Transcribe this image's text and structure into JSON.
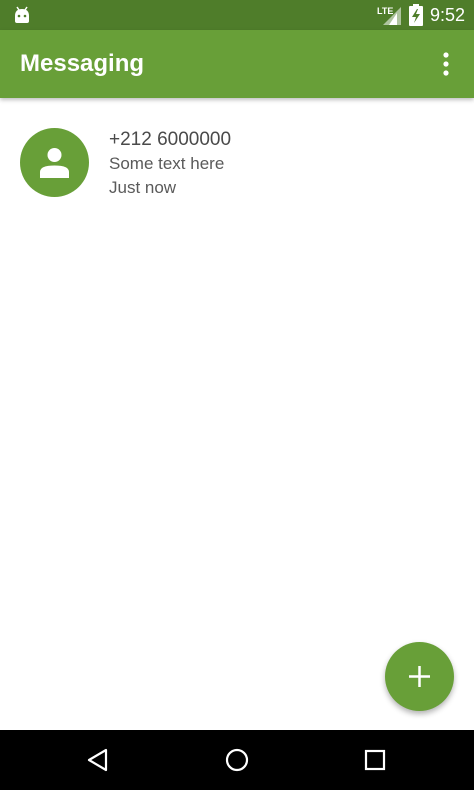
{
  "status_bar": {
    "network": "LTE",
    "time": "9:52"
  },
  "app_bar": {
    "title": "Messaging",
    "menu_icon": "overflow-menu-icon"
  },
  "conversations": [
    {
      "avatar_icon": "person-icon",
      "title": "+212 6000000",
      "snippet": "Some text here",
      "time": "Just now"
    }
  ],
  "fab": {
    "icon": "plus-icon"
  },
  "navigation": {
    "icons": [
      "back-icon",
      "home-icon",
      "recents-icon"
    ]
  },
  "colors": {
    "primary": "#689f38",
    "primary_dark": "#4f7d2a",
    "nav_bar": "#000000"
  }
}
